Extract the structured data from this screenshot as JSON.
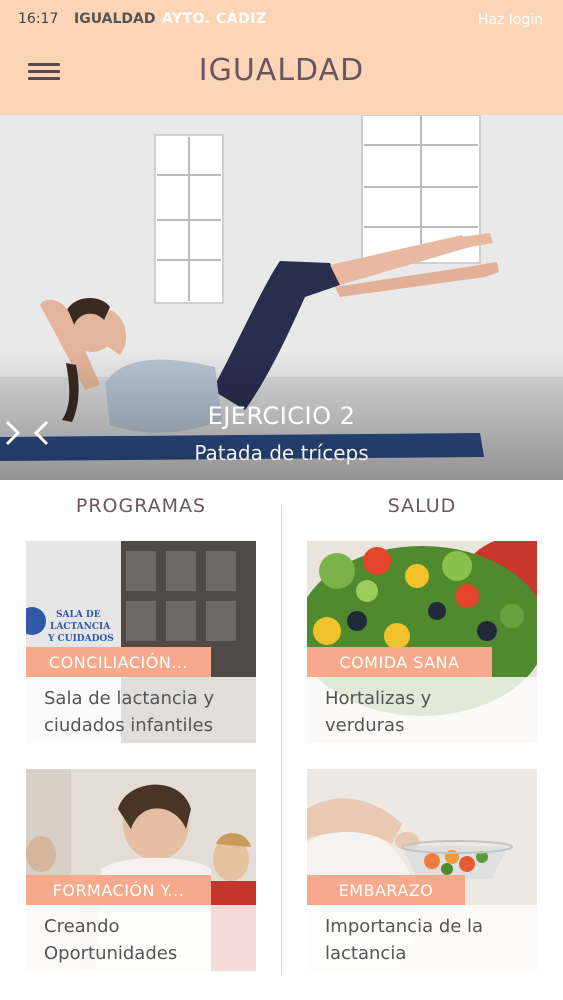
{
  "status_bar": {
    "time": "16:17",
    "app_label": "IGUALDAD",
    "org_label": "AYTO. CÁDIZ",
    "login_label": "Haz login"
  },
  "header": {
    "title": "IGUALDAD",
    "menu_icon": "hamburger-menu-icon"
  },
  "hero": {
    "title": "EJERCICIO 2",
    "subtitle": "Patada de tríceps",
    "prev_icon": "chevron-left-icon",
    "next_icon": "chevron-right-icon"
  },
  "sections": {
    "left_title": "PROGRAMAS",
    "right_title": "SALUD"
  },
  "cards": [
    {
      "tag": "CONCILIACIÓN...",
      "line1": "Sala de lactancia y",
      "line2": "ciudados infantiles"
    },
    {
      "tag": "COMIDA SANA",
      "line1": "Hortalizas y",
      "line2": "verduras"
    },
    {
      "tag": "FORMACIÓN Y...",
      "line1": "Creando",
      "line2": "Oportunidades"
    },
    {
      "tag": "EMBARAZO",
      "line1": "Importancia de la",
      "line2": "lactancia"
    }
  ],
  "photo_sign": "SALA DE LACTANCIA Y CUIDADOS INFANTILES",
  "colors": {
    "header_bg": "#fcd5b7",
    "title_text": "#6a5560",
    "tag_bg": "#f6a98b"
  }
}
